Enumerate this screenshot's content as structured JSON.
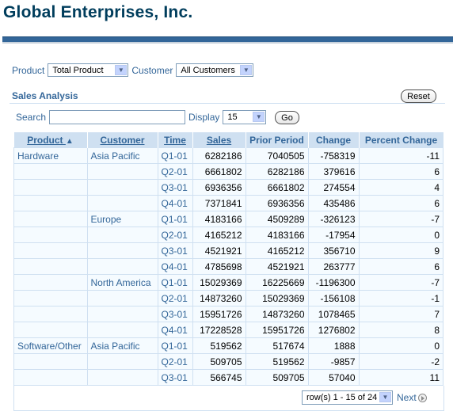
{
  "header": {
    "title": "Global Enterprises, Inc."
  },
  "filters": {
    "product_label": "Product",
    "product_value": "Total Product",
    "customer_label": "Customer",
    "customer_value": "All Customers"
  },
  "section": {
    "title": "Sales Analysis",
    "reset_label": "Reset"
  },
  "search": {
    "label": "Search",
    "value": "",
    "display_label": "Display",
    "display_value": "15",
    "go_label": "Go"
  },
  "table": {
    "columns": [
      "Product",
      "Customer",
      "Time",
      "Sales",
      "Prior Period",
      "Change",
      "Percent Change"
    ],
    "sort_indicator": "▲",
    "rows": [
      {
        "product": "Hardware",
        "customer": "Asia Pacific",
        "time": "Q1-01",
        "sales": "6282186",
        "prior": "7040505",
        "change": "-758319",
        "pct": "-11"
      },
      {
        "product": "",
        "customer": "",
        "time": "Q2-01",
        "sales": "6661802",
        "prior": "6282186",
        "change": "379616",
        "pct": "6"
      },
      {
        "product": "",
        "customer": "",
        "time": "Q3-01",
        "sales": "6936356",
        "prior": "6661802",
        "change": "274554",
        "pct": "4"
      },
      {
        "product": "",
        "customer": "",
        "time": "Q4-01",
        "sales": "7371841",
        "prior": "6936356",
        "change": "435486",
        "pct": "6"
      },
      {
        "product": "",
        "customer": "Europe",
        "time": "Q1-01",
        "sales": "4183166",
        "prior": "4509289",
        "change": "-326123",
        "pct": "-7"
      },
      {
        "product": "",
        "customer": "",
        "time": "Q2-01",
        "sales": "4165212",
        "prior": "4183166",
        "change": "-17954",
        "pct": "0"
      },
      {
        "product": "",
        "customer": "",
        "time": "Q3-01",
        "sales": "4521921",
        "prior": "4165212",
        "change": "356710",
        "pct": "9"
      },
      {
        "product": "",
        "customer": "",
        "time": "Q4-01",
        "sales": "4785698",
        "prior": "4521921",
        "change": "263777",
        "pct": "6"
      },
      {
        "product": "",
        "customer": "North America",
        "time": "Q1-01",
        "sales": "15029369",
        "prior": "16225669",
        "change": "-1196300",
        "pct": "-7"
      },
      {
        "product": "",
        "customer": "",
        "time": "Q2-01",
        "sales": "14873260",
        "prior": "15029369",
        "change": "-156108",
        "pct": "-1"
      },
      {
        "product": "",
        "customer": "",
        "time": "Q3-01",
        "sales": "15951726",
        "prior": "14873260",
        "change": "1078465",
        "pct": "7"
      },
      {
        "product": "",
        "customer": "",
        "time": "Q4-01",
        "sales": "17228528",
        "prior": "15951726",
        "change": "1276802",
        "pct": "8"
      },
      {
        "product": "Software/Other",
        "customer": "Asia Pacific",
        "time": "Q1-01",
        "sales": "519562",
        "prior": "517674",
        "change": "1888",
        "pct": "0"
      },
      {
        "product": "",
        "customer": "",
        "time": "Q2-01",
        "sales": "509705",
        "prior": "519562",
        "change": "-9857",
        "pct": "-2"
      },
      {
        "product": "",
        "customer": "",
        "time": "Q3-01",
        "sales": "566745",
        "prior": "509705",
        "change": "57040",
        "pct": "11"
      }
    ]
  },
  "pager": {
    "range_value": "row(s) 1 - 15 of 24",
    "next_label": "Next"
  }
}
